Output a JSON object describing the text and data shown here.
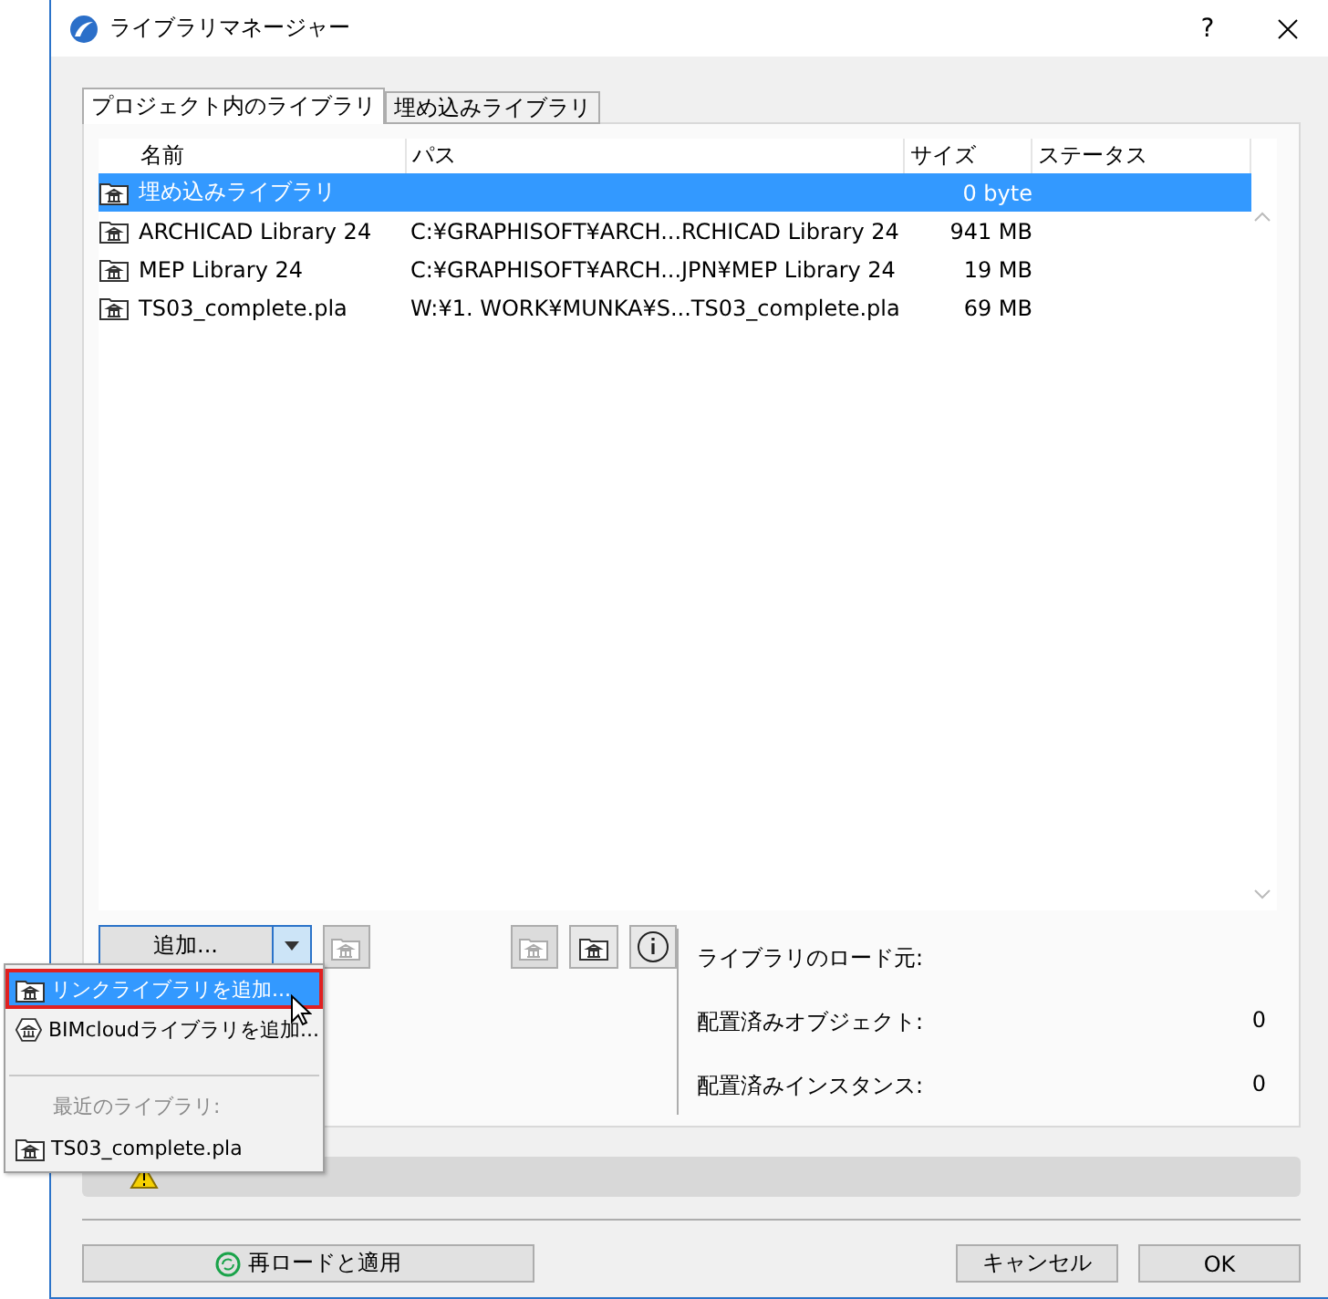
{
  "window": {
    "title": "ライブラリマネージャー",
    "help": "?"
  },
  "tabs": [
    {
      "label": "プロジェクト内のライブラリ",
      "selected": true
    },
    {
      "label": "埋め込みライブラリ",
      "selected": false
    }
  ],
  "table": {
    "columns": [
      "名前",
      "パス",
      "サイズ",
      "ステータス"
    ],
    "rows": [
      {
        "name": "埋め込みライブラリ",
        "path": "",
        "size": "0 byte",
        "selected": true
      },
      {
        "name": "ARCHICAD Library 24",
        "path": "C:¥GRAPHISOFT¥ARCH...RCHICAD Library 24",
        "size": "941 MB",
        "selected": false
      },
      {
        "name": "MEP Library 24",
        "path": "C:¥GRAPHISOFT¥ARCH...JPN¥MEP Library 24",
        "size": "19 MB",
        "selected": false
      },
      {
        "name": "TS03_complete.pla",
        "path": "W:¥1. WORK¥MUNKA¥S...TS03_complete.pla",
        "size": "69 MB",
        "selected": false
      }
    ]
  },
  "add_button": {
    "label": "追加..."
  },
  "info": [
    {
      "label": "ライブラリのロード元:"
    },
    {
      "label": "配置済みオブジェクト:",
      "value": "0"
    },
    {
      "label": "配置済みインスタンス:",
      "value": "0"
    }
  ],
  "menu": [
    {
      "kind": "item",
      "label": "リンクライブラリを追加...",
      "selected": true
    },
    {
      "kind": "cloud",
      "label": "BIMcloudライブラリを追加...",
      "selected": false
    },
    {
      "kind": "heading",
      "label": "最近のライブラリ:"
    },
    {
      "kind": "item",
      "label": "TS03_complete.pla",
      "selected": false
    }
  ],
  "footer": {
    "reload": "再ロードと適用",
    "cancel": "キャンセル",
    "ok": "OK"
  }
}
